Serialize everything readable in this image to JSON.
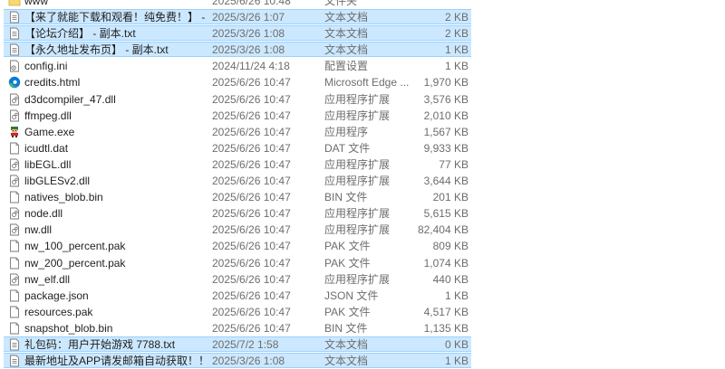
{
  "files": [
    {
      "name": "www",
      "date": "2025/6/26 10:48",
      "type": "文件夹",
      "size": "",
      "icon": "folder-icon",
      "selected": false
    },
    {
      "name": "【来了就能下载和观看！纯免费！】 - 副...",
      "date": "2025/3/26 1:07",
      "type": "文本文档",
      "size": "2 KB",
      "icon": "text-file-icon",
      "selected": true
    },
    {
      "name": "【论坛介绍】 - 副本.txt",
      "date": "2025/3/26 1:08",
      "type": "文本文档",
      "size": "2 KB",
      "icon": "text-file-icon",
      "selected": true
    },
    {
      "name": "【永久地址发布页】 - 副本.txt",
      "date": "2025/3/26 1:08",
      "type": "文本文档",
      "size": "1 KB",
      "icon": "text-file-icon",
      "selected": true
    },
    {
      "name": "config.ini",
      "date": "2024/11/24 4:18",
      "type": "配置设置",
      "size": "1 KB",
      "icon": "config-file-icon",
      "selected": false
    },
    {
      "name": "credits.html",
      "date": "2025/6/26 10:47",
      "type": "Microsoft Edge ...",
      "size": "1,970 KB",
      "icon": "edge-icon",
      "selected": false
    },
    {
      "name": "d3dcompiler_47.dll",
      "date": "2025/6/26 10:47",
      "type": "应用程序扩展",
      "size": "3,576 KB",
      "icon": "dll-file-icon",
      "selected": false
    },
    {
      "name": "ffmpeg.dll",
      "date": "2025/6/26 10:47",
      "type": "应用程序扩展",
      "size": "2,010 KB",
      "icon": "dll-file-icon",
      "selected": false
    },
    {
      "name": "Game.exe",
      "date": "2025/6/26 10:47",
      "type": "应用程序",
      "size": "1,567 KB",
      "icon": "game-exe-icon",
      "selected": false
    },
    {
      "name": "icudtl.dat",
      "date": "2025/6/26 10:47",
      "type": "DAT 文件",
      "size": "9,933 KB",
      "icon": "blank-file-icon",
      "selected": false
    },
    {
      "name": "libEGL.dll",
      "date": "2025/6/26 10:47",
      "type": "应用程序扩展",
      "size": "77 KB",
      "icon": "dll-file-icon",
      "selected": false
    },
    {
      "name": "libGLESv2.dll",
      "date": "2025/6/26 10:47",
      "type": "应用程序扩展",
      "size": "3,644 KB",
      "icon": "dll-file-icon",
      "selected": false
    },
    {
      "name": "natives_blob.bin",
      "date": "2025/6/26 10:47",
      "type": "BIN 文件",
      "size": "201 KB",
      "icon": "blank-file-icon",
      "selected": false
    },
    {
      "name": "node.dll",
      "date": "2025/6/26 10:47",
      "type": "应用程序扩展",
      "size": "5,615 KB",
      "icon": "dll-file-icon",
      "selected": false
    },
    {
      "name": "nw.dll",
      "date": "2025/6/26 10:47",
      "type": "应用程序扩展",
      "size": "82,404 KB",
      "icon": "dll-file-icon",
      "selected": false
    },
    {
      "name": "nw_100_percent.pak",
      "date": "2025/6/26 10:47",
      "type": "PAK 文件",
      "size": "809 KB",
      "icon": "blank-file-icon",
      "selected": false
    },
    {
      "name": "nw_200_percent.pak",
      "date": "2025/6/26 10:47",
      "type": "PAK 文件",
      "size": "1,074 KB",
      "icon": "blank-file-icon",
      "selected": false
    },
    {
      "name": "nw_elf.dll",
      "date": "2025/6/26 10:47",
      "type": "应用程序扩展",
      "size": "440 KB",
      "icon": "dll-file-icon",
      "selected": false
    },
    {
      "name": "package.json",
      "date": "2025/6/26 10:47",
      "type": "JSON 文件",
      "size": "1 KB",
      "icon": "blank-file-icon",
      "selected": false
    },
    {
      "name": "resources.pak",
      "date": "2025/6/26 10:47",
      "type": "PAK 文件",
      "size": "4,517 KB",
      "icon": "blank-file-icon",
      "selected": false
    },
    {
      "name": "snapshot_blob.bin",
      "date": "2025/6/26 10:47",
      "type": "BIN 文件",
      "size": "1,135 KB",
      "icon": "blank-file-icon",
      "selected": false
    },
    {
      "name": "礼包码：用户开始游戏  7788.txt",
      "date": "2025/7/2 1:58",
      "type": "文本文档",
      "size": "0 KB",
      "icon": "text-file-icon",
      "selected": true
    },
    {
      "name": "最新地址及APP请发邮箱自动获取！！！",
      "date": "2025/3/26 1:08",
      "type": "文本文档",
      "size": "1 KB",
      "icon": "text-file-icon",
      "selected": true
    }
  ],
  "colors": {
    "selection_fill": "#cce8ff",
    "selection_border": "#99d1ff",
    "folder": "#f8d775",
    "edge_blue": "#0c7bd6",
    "edge_green": "#3fc55e"
  }
}
